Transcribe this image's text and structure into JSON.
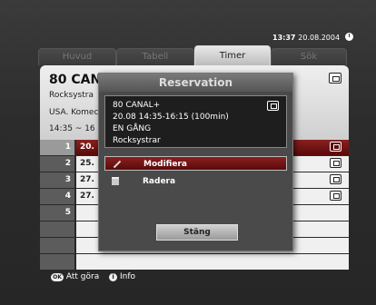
{
  "clock": {
    "time": "13:37",
    "date": "20.08.2004"
  },
  "tabs": [
    {
      "label": "Huvud",
      "active": false
    },
    {
      "label": "Tabell",
      "active": false
    },
    {
      "label": "Timer",
      "active": true
    },
    {
      "label": "Sök",
      "active": false
    }
  ],
  "program": {
    "channel": "80 CANAL",
    "title": "Rocksystra",
    "genre": "USA. Komec",
    "time": "14:35 ~ 16"
  },
  "rows": [
    {
      "num": "1",
      "date": "20."
    },
    {
      "num": "2",
      "date": "25."
    },
    {
      "num": "3",
      "date": "27."
    },
    {
      "num": "4",
      "date": "27."
    },
    {
      "num": "5",
      "date": ""
    }
  ],
  "dialog": {
    "title": "Reservation",
    "info": {
      "channel": "80 CANAL+",
      "datetime": "20.08  14:35-16:15 (100min)",
      "repeat": "EN GÅNG",
      "program": "Rocksystrar"
    },
    "menu": [
      {
        "label": "Modifiera",
        "icon": "pencil-icon"
      },
      {
        "label": "Radera",
        "icon": "trash-icon"
      }
    ],
    "close_label": "Stäng"
  },
  "footer": {
    "ok_key": "OK",
    "ok_label": "Att göra",
    "info_key": "i",
    "info_label": "Info"
  }
}
